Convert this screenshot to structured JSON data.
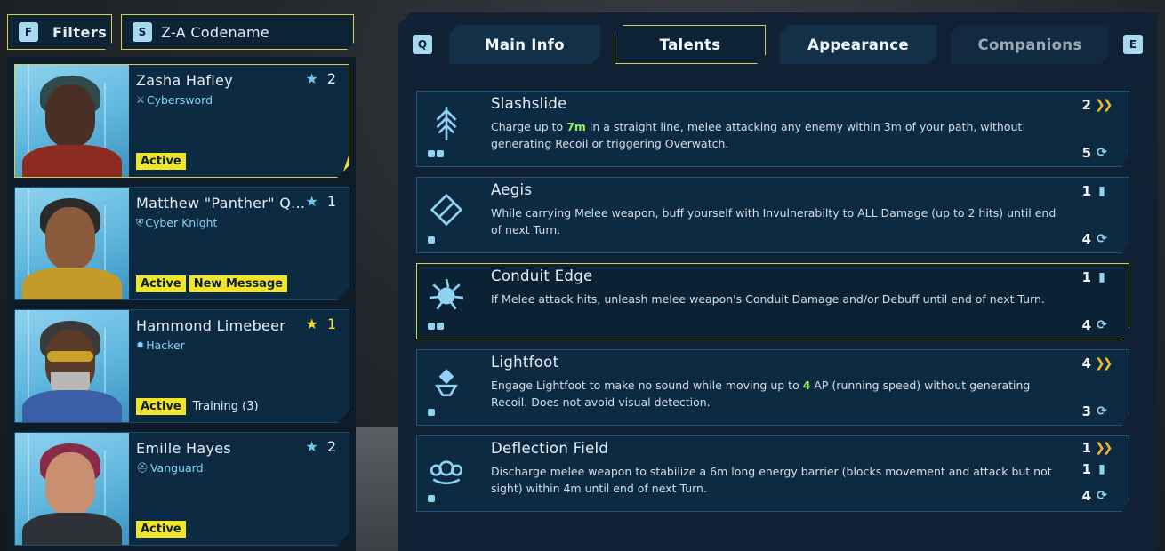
{
  "topbar": {
    "filter_key": "F",
    "filter_label": "Filters",
    "sort_key": "S",
    "sort_label": "Z-A Codename"
  },
  "characters": [
    {
      "name": "Zasha Hafley",
      "class": "Cybersword",
      "rank": "2",
      "badges": [
        "Active"
      ],
      "extra": ""
    },
    {
      "name": "Matthew \"Panther\" Q...",
      "class": "Cyber Knight",
      "rank": "1",
      "badges": [
        "Active",
        "New Message"
      ],
      "extra": ""
    },
    {
      "name": "Hammond Limebeer",
      "class": "Hacker",
      "rank": "1",
      "badges": [
        "Active"
      ],
      "extra": "Training (3)"
    },
    {
      "name": "Emille Hayes",
      "class": "Vanguard",
      "rank": "2",
      "badges": [
        "Active"
      ],
      "extra": ""
    }
  ],
  "tabs": {
    "prev_key": "Q",
    "next_key": "E",
    "items": [
      "Main Info",
      "Talents",
      "Appearance",
      "Companions"
    ],
    "active": "Talents"
  },
  "talents": [
    {
      "name": "Slashslide",
      "desc_pre": "Charge up to ",
      "desc_hl": "7m",
      "desc_post": " in a straight line, melee attacking any enemy within 3m of your path, without generating Recoil or triggering Overwatch.",
      "ap": "2",
      "charges": "",
      "cooldown": "5",
      "dots": 2,
      "icon": "slash-arrow-icon"
    },
    {
      "name": "Aegis",
      "desc_pre": "While carrying Melee weapon, buff yourself with Invulnerabilty to ALL Damage (up to 2 hits) until end of next Turn.",
      "desc_hl": "",
      "desc_post": "",
      "ap": "",
      "charges": "1",
      "cooldown": "4",
      "dots": 1,
      "icon": "shield-icon"
    },
    {
      "name": "Conduit Edge",
      "desc_pre": "If Melee attack hits, unleash melee weapon's Conduit Damage and/or Debuff until end of next Turn.",
      "desc_hl": "",
      "desc_post": "",
      "ap": "",
      "charges": "1",
      "cooldown": "4",
      "dots": 2,
      "icon": "spiked-orb-icon"
    },
    {
      "name": "Lightfoot",
      "desc_pre": "Engage Lightfoot to make no sound while moving up to ",
      "desc_hl": "4",
      "desc_post": " AP (running speed) without generating Recoil. Does not avoid visual detection.",
      "ap": "4",
      "charges": "",
      "cooldown": "3",
      "dots": 1,
      "icon": "foot-icon"
    },
    {
      "name": "Deflection Field",
      "desc_pre": "Discharge melee weapon to stabilize a 6m long energy barrier (blocks movement and attack but not sight) within 4m until end of next Turn.",
      "desc_hl": "",
      "desc_post": "",
      "ap": "1",
      "charges": "1",
      "cooldown": "4",
      "dots": 1,
      "icon": "barrier-icon"
    }
  ],
  "colors": {
    "accent_yellow": "#f0e52a",
    "class_cyan": "#7ed6f6",
    "highlight_green": "#8ef05a",
    "ap_orange": "#f2b632"
  }
}
